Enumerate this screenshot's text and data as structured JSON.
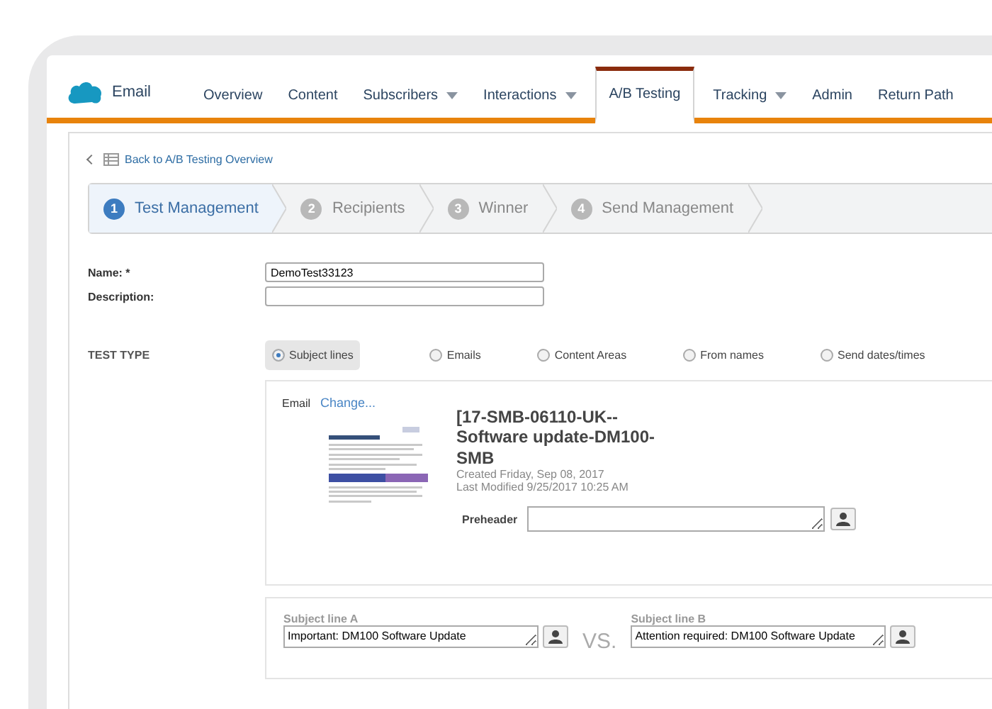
{
  "nav": {
    "app_name": "Email",
    "tabs": [
      {
        "label": "Overview",
        "dropdown": false,
        "selected": false
      },
      {
        "label": "Content",
        "dropdown": false,
        "selected": false
      },
      {
        "label": "Subscribers",
        "dropdown": true,
        "selected": false
      },
      {
        "label": "Interactions",
        "dropdown": true,
        "selected": false
      },
      {
        "label": "A/B Testing",
        "dropdown": false,
        "selected": true
      },
      {
        "label": "Tracking",
        "dropdown": true,
        "selected": false
      },
      {
        "label": "Admin",
        "dropdown": false,
        "selected": false
      },
      {
        "label": "Return Path",
        "dropdown": false,
        "selected": false
      }
    ]
  },
  "back_link": "Back to A/B Testing Overview",
  "steps": [
    {
      "number": "1",
      "label": "Test Management",
      "selected": true
    },
    {
      "number": "2",
      "label": "Recipients",
      "selected": false
    },
    {
      "number": "3",
      "label": "Winner",
      "selected": false
    },
    {
      "number": "4",
      "label": "Send Management",
      "selected": false
    }
  ],
  "form": {
    "name": {
      "label": "Name: *",
      "value": "DemoTest33123"
    },
    "description": {
      "label": "Description:"
    }
  },
  "test_type": {
    "label": "TEST TYPE",
    "options": [
      {
        "label": "Subject lines",
        "selected": true
      },
      {
        "label": "Emails",
        "selected": false
      },
      {
        "label": "Content Areas",
        "selected": false
      },
      {
        "label": "From names",
        "selected": false
      },
      {
        "label": "Send dates/times",
        "selected": false
      }
    ]
  },
  "email": {
    "label": "Email",
    "change_link": "Change...",
    "title": "[17-SMB-06110-UK--Software update-DM100-SMB",
    "created": "Created Friday, Sep 08, 2017",
    "modified": "Last Modified 9/25/2017 10:25 AM",
    "preheader_label": "Preheader"
  },
  "subjects": [
    {
      "label": "Subject line A",
      "value": "Important: DM100 Software Update"
    },
    {
      "label": "Subject line B",
      "value": "Attention required: DM100 Software Update"
    }
  ],
  "vs": "VS."
}
